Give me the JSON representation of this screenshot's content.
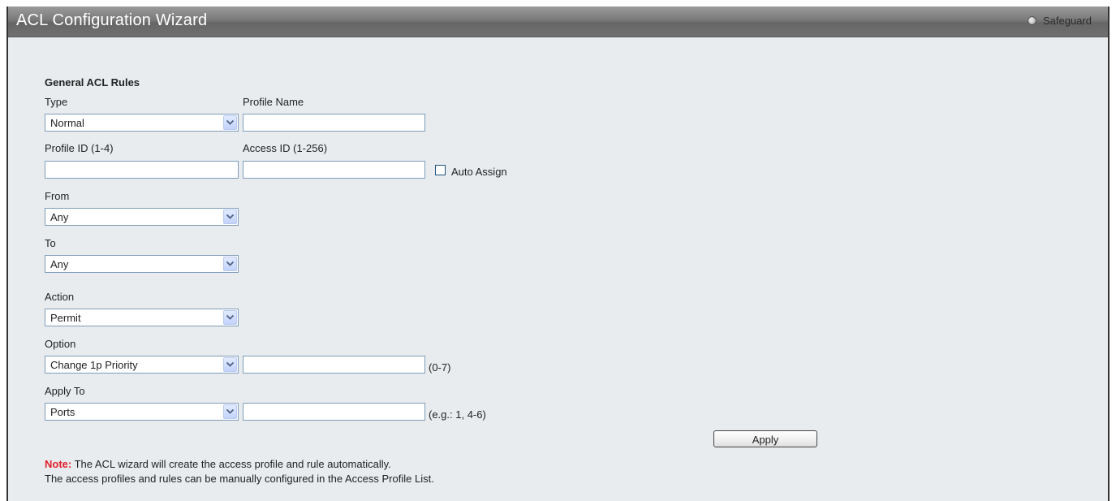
{
  "header": {
    "title": "ACL Configuration Wizard",
    "safeguard_label": "Safeguard"
  },
  "form": {
    "section_title": "General ACL Rules",
    "type_label": "Type",
    "type_value": "Normal",
    "profile_name_label": "Profile Name",
    "profile_name_value": "",
    "profile_id_label": "Profile ID (1-4)",
    "profile_id_value": "",
    "access_id_label": "Access ID (1-256)",
    "access_id_value": "",
    "auto_assign_label": "Auto Assign",
    "auto_assign_checked": false,
    "from_label": "From",
    "from_value": "Any",
    "to_label": "To",
    "to_value": "Any",
    "action_label": "Action",
    "action_value": "Permit",
    "option_label": "Option",
    "option_value": "Change 1p Priority",
    "option_hint": "(0-7)",
    "apply_to_label": "Apply To",
    "apply_to_value": "Ports",
    "apply_to_hint": "(e.g.: 1, 4-6)",
    "apply_button": "Apply"
  },
  "notes": {
    "note_prefix": "Note:",
    "line1": " The ACL wizard will create the access profile and rule automatically.",
    "line2": "The access profiles and rules can be manually configured in the Access Profile List."
  },
  "colors": {
    "note_accent": "#e0202a",
    "panel_background": "#e8ecef",
    "titlebar": "#7a7a7a"
  },
  "icons": {
    "dropdown": "chevron-down-icon",
    "safeguard": "safeguard-indicator-icon"
  }
}
